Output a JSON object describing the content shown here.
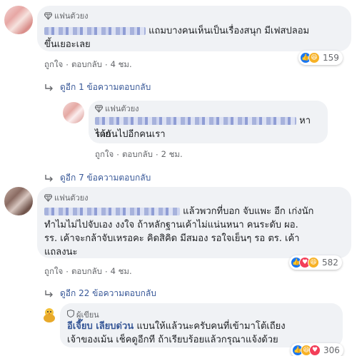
{
  "colors": {
    "link": "#385898",
    "meta": "#65676b",
    "bubble": "#f0f2f5",
    "like": "#1877f2",
    "haha": "#f7b125",
    "love": "#f33e58"
  },
  "comments": [
    {
      "badge": "แฟนตัวยง",
      "text_line1": "แถมบางคนเห็นเป็นเรื่องสนุก มีเฟสปลอม",
      "text_line2": "ขึ้นเยอะเลย",
      "like": "ถูกใจ",
      "reply": "ตอบกลับ",
      "time": "4 ชม.",
      "reaction_count": "159",
      "reactions": [
        "like-icon",
        "haha-icon"
      ],
      "replies_link": "ดูอีก 1 ข้อความตอบกลับ"
    },
    {
      "badge": "แฟนตัวยง",
      "text_line1": "หาราย",
      "text_line2": "ได้กันไปอีกคนเรา",
      "like": "ถูกใจ",
      "reply": "ตอบกลับ",
      "time": "2 ชม.",
      "replies_link": "ดูอีก 7 ข้อความตอบกลับ"
    },
    {
      "badge": "แฟนตัวยง",
      "text_line1": "แล้วพวกที่บอก จับแพะ อีก เก่งนัก",
      "text_line2": "ทำไมไม่ไปจับเอง งงใจ ถ้าหลักฐานเค้าไม่แน่นหนา คนระดับ ผอ.",
      "text_line3": "รร. เค้าจะกล้าจับเหรอคะ คิดสิคิด มีสมอง รอใจเย็นๆ รอ ตร. เค้า",
      "text_line4": "แถลงนะ",
      "like": "ถูกใจ",
      "reply": "ตอบกลับ",
      "time": "4 ชม.",
      "reaction_count": "582",
      "reactions": [
        "like-icon",
        "love-icon",
        "haha-icon"
      ],
      "replies_link": "ดูอีก 22 ข้อความตอบกลับ"
    },
    {
      "badge": "ผู้เขียน",
      "author": "อีเจี๊ยบ เลียบด่วน",
      "text_line1": "แบนให้แล้วนะครับคนที่เข้ามาโต้เถียง",
      "text_line2": "เจ้าของเม้น เช็คดูอีกที ถ้าเรียบร้อยแล้วกรุณาแจ้งด้วย",
      "reaction_count": "306",
      "reactions": [
        "like-icon",
        "haha-icon",
        "love-icon"
      ]
    }
  ]
}
